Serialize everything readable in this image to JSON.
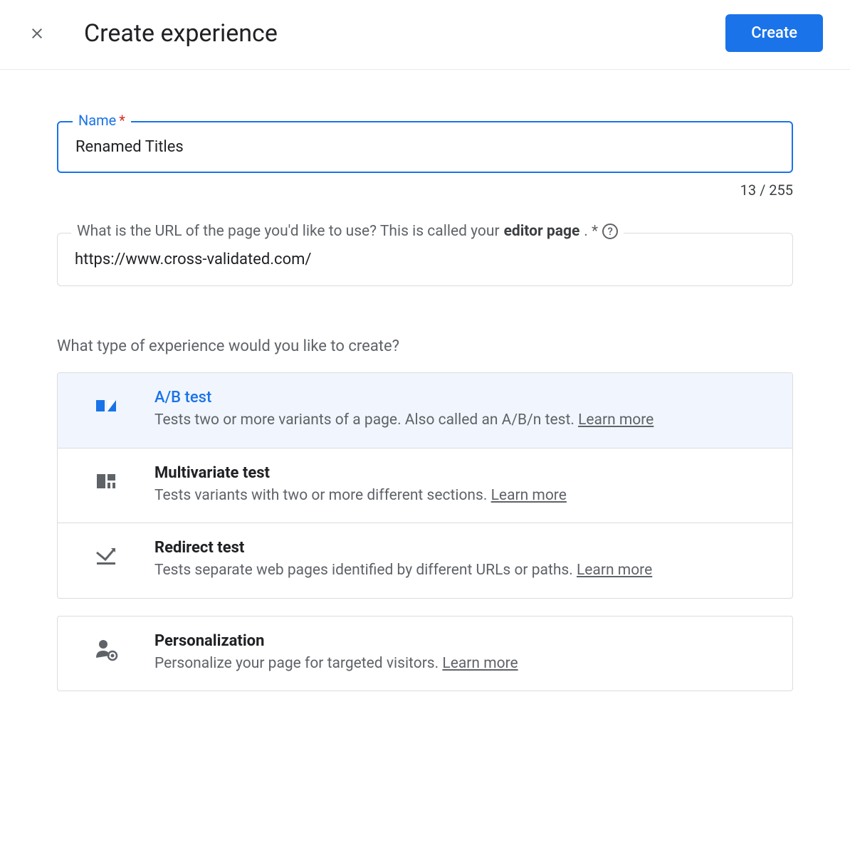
{
  "header": {
    "title": "Create experience",
    "create_button": "Create"
  },
  "name_field": {
    "label": "Name",
    "required_marker": "*",
    "value": "Renamed Titles",
    "counter": "13 / 255"
  },
  "url_field": {
    "label_pre": "What is the URL of the page you'd like to use? This is called your ",
    "label_bold": "editor page",
    "label_post": ". *",
    "value": "https://www.cross-validated.com/"
  },
  "type_question": "What type of experience would you like to create?",
  "options": [
    {
      "key": "abtest",
      "title": "A/B test",
      "desc": "Tests two or more variants of a page. Also called an A/B/n test. ",
      "learn": "Learn more",
      "selected": true
    },
    {
      "key": "multivariate",
      "title": "Multivariate test",
      "desc": "Tests variants with two or more different sections. ",
      "learn": "Learn more",
      "selected": false
    },
    {
      "key": "redirect",
      "title": "Redirect test",
      "desc": "Tests separate web pages identified by different URLs or paths. ",
      "learn": "Learn more",
      "selected": false
    }
  ],
  "personalization": {
    "key": "personalization",
    "title": "Personalization",
    "desc": "Personalize your page for targeted visitors. ",
    "learn": "Learn more"
  }
}
